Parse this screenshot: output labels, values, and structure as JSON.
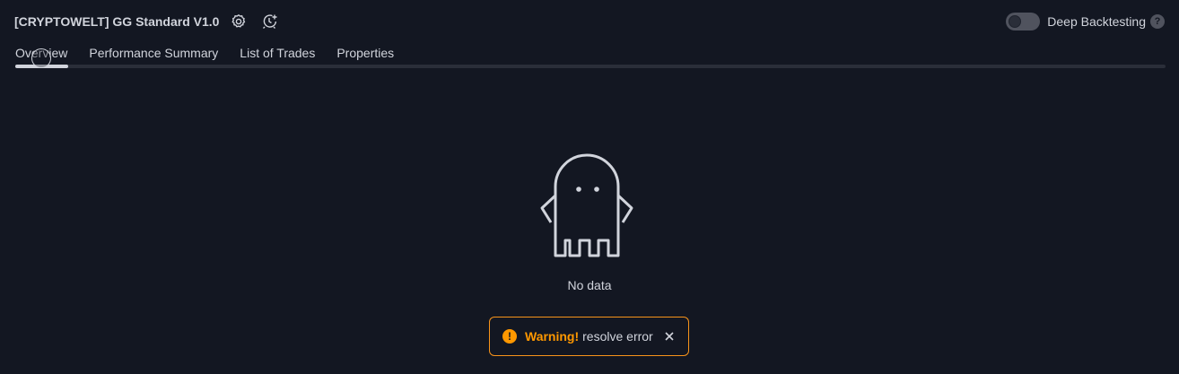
{
  "header": {
    "title": "[CRYPTOWELT] GG Standard V1.0",
    "settings_icon": "gear-icon",
    "alert_icon": "add-alert-icon"
  },
  "deep_backtesting": {
    "label": "Deep Backtesting",
    "enabled": false,
    "help_glyph": "?"
  },
  "tabs": [
    {
      "label": "Overview",
      "active": true
    },
    {
      "label": "Performance Summary",
      "active": false
    },
    {
      "label": "List of Trades",
      "active": false
    },
    {
      "label": "Properties",
      "active": false
    }
  ],
  "empty_state": {
    "icon": "ghost-icon",
    "text": "No data"
  },
  "toast": {
    "icon_glyph": "!",
    "title": "Warning!",
    "message": "resolve error",
    "close_icon": "close-icon"
  },
  "colors": {
    "background": "#131722",
    "text": "#d1d4dc",
    "warning": "#ff9800",
    "toast_border": "#f7931a"
  }
}
